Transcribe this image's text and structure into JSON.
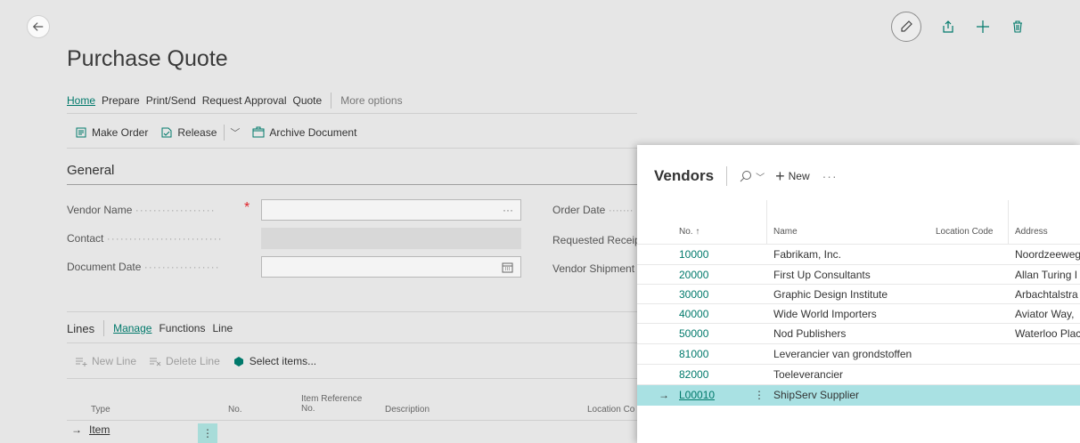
{
  "page": {
    "title": "Purchase Quote"
  },
  "action_tabs": [
    "Home",
    "Prepare",
    "Print/Send",
    "Request Approval",
    "Quote"
  ],
  "more_options": "More options",
  "actions": {
    "make_order": "Make Order",
    "release": "Release",
    "archive": "Archive Document"
  },
  "general": {
    "title": "General",
    "vendor_name_label": "Vendor Name",
    "contact_label": "Contact",
    "document_date_label": "Document Date",
    "order_date_label": "Order Date",
    "requested_receipt_label": "Requested Receip",
    "vendor_shipment_label": "Vendor Shipment",
    "more_glyph": "···"
  },
  "lines": {
    "title": "Lines",
    "tabs": [
      "Manage",
      "Functions",
      "Line"
    ],
    "new_line": "New Line",
    "delete_line": "Delete Line",
    "select_items": "Select items...",
    "columns": {
      "type": "Type",
      "no": "No.",
      "item_reference_1": "Item Reference",
      "item_reference_2": "No.",
      "description": "Description",
      "location": "Location Co"
    },
    "row_type": "Item"
  },
  "vendors": {
    "title": "Vendors",
    "new_label": "New",
    "more": "···",
    "columns": {
      "no": "No. ↑",
      "name": "Name",
      "location_code": "Location Code",
      "address": "Address"
    },
    "rows": [
      {
        "no": "10000",
        "name": "Fabrikam, Inc.",
        "address": "Noordzeeweg"
      },
      {
        "no": "20000",
        "name": "First Up Consultants",
        "address": "Allan Turing I"
      },
      {
        "no": "30000",
        "name": "Graphic Design Institute",
        "address": "Arbachtalstra"
      },
      {
        "no": "40000",
        "name": "Wide World Importers",
        "address": "Aviator Way,"
      },
      {
        "no": "50000",
        "name": "Nod Publishers",
        "address": "Waterloo Plac"
      },
      {
        "no": "81000",
        "name": "Leverancier van grondstoffen",
        "address": ""
      },
      {
        "no": "82000",
        "name": "Toeleverancier",
        "address": ""
      },
      {
        "no": "L00010",
        "name": "ShipServ Supplier",
        "address": ""
      }
    ],
    "selected_arrow": "→",
    "row_dots": "⋮"
  },
  "colors": {
    "accent": "#00796b",
    "selected_row": "#a9e1e3",
    "required": "#e0242b"
  }
}
